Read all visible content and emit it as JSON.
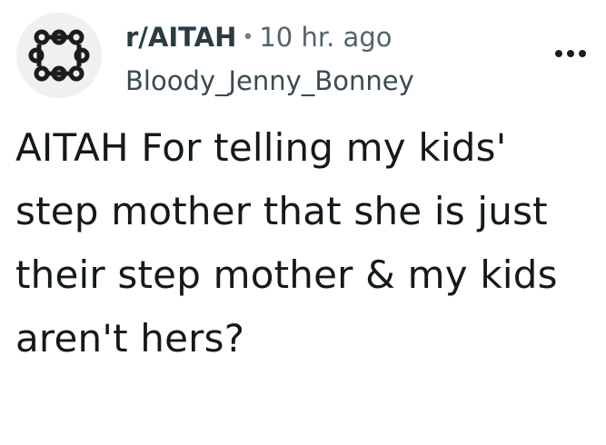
{
  "post": {
    "community": "r/AITAH",
    "separator": "•",
    "time_ago": "10 hr. ago",
    "author": "Bloody_Jenny_Bonney",
    "title": "AITAH For telling my kids' step mother that she is just their step mother & my kids aren't hers?"
  },
  "icons": {
    "community_avatar": "community-network-icon",
    "overflow_menu": "more-options-icon"
  },
  "colors": {
    "text": "#1c1c1c",
    "meta": "#53626a",
    "avatar_bg": "#eef0f2"
  }
}
